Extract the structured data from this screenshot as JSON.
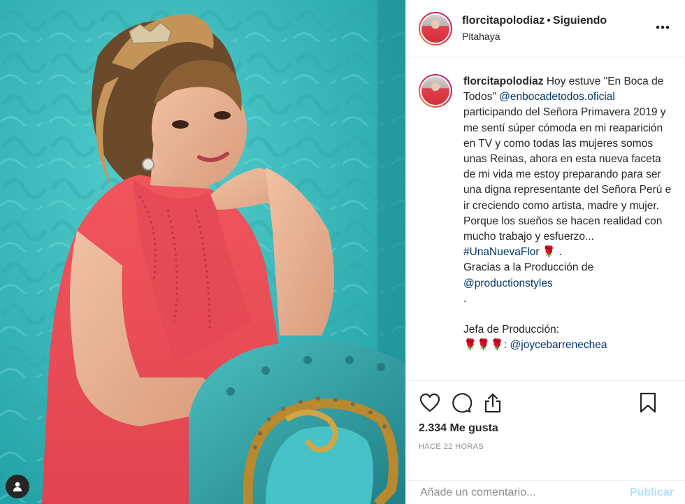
{
  "post": {
    "image_alt": "Mujer con vestido de encaje rojo apoyada en un sillón turquesa",
    "colors": {
      "background": "#3fb6b6",
      "dress": "#ea4a55",
      "sofa": "#3aa6a8",
      "gold": "#b8892e"
    }
  },
  "header": {
    "username": "florcitapolodiaz",
    "separator": "•",
    "follow_status": "Siguiendo",
    "location": "Pitahaya",
    "more_icon": "more-horizontal-icon"
  },
  "caption": {
    "username": "florcitapolodiaz",
    "segments": [
      {
        "type": "text",
        "value": " Hoy estuve \"En Boca de Todos\" "
      },
      {
        "type": "link",
        "value": "@enbocadetodos.oficial"
      },
      {
        "type": "text",
        "value": " participando del Señora Primavera 2019 y me sentí súper cómoda en mi reaparición en TV y como todas las mujeres somos unas Reinas, ahora en esta nueva faceta de mi vida me estoy preparando para ser una digna representante del Señora Perú e ir creciendo como artista, madre y mujer."
      },
      {
        "type": "break"
      },
      {
        "type": "text",
        "value": "Porque los sueños se hacen realidad con mucho trabajo y esfuerzo..."
      },
      {
        "type": "break"
      },
      {
        "type": "link",
        "value": "#UnaNuevaFlor"
      },
      {
        "type": "text",
        "value": " 🌹 ."
      },
      {
        "type": "break"
      },
      {
        "type": "text",
        "value": "Gracias a la Producción de"
      },
      {
        "type": "break"
      },
      {
        "type": "link",
        "value": "@productionstyles"
      },
      {
        "type": "break"
      },
      {
        "type": "text",
        "value": "."
      },
      {
        "type": "break"
      },
      {
        "type": "break"
      },
      {
        "type": "text",
        "value": "Jefa de Producción:"
      },
      {
        "type": "break"
      },
      {
        "type": "text",
        "value": "🌹🌹🌹: "
      },
      {
        "type": "link",
        "value": "@joycebarrenechea"
      }
    ]
  },
  "actions": {
    "like_icon": "heart-icon",
    "comment_icon": "comment-icon",
    "share_icon": "share-icon",
    "save_icon": "bookmark-icon"
  },
  "likes": "2.334 Me gusta",
  "timestamp": "Hace 22 horas",
  "comment_box": {
    "placeholder": "Añade un comentario...",
    "publish_label": "Publicar"
  }
}
